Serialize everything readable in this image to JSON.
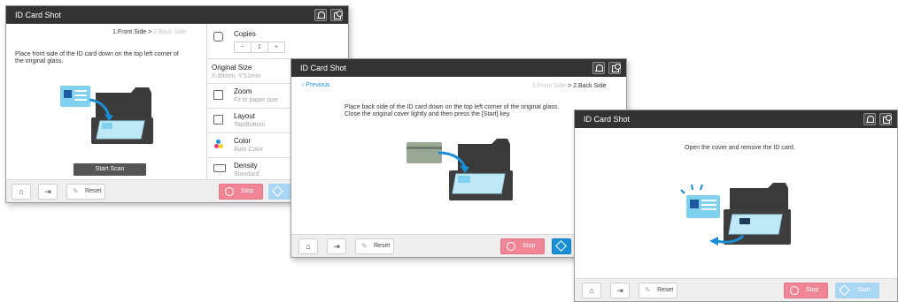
{
  "colors": {
    "titlebar": "#333333",
    "stop": "#f08596",
    "start": "#1a8fd6",
    "card": "#7fd1ef",
    "accent_arrow": "#1a8fd6"
  },
  "screen1": {
    "title": "ID Card Shot",
    "step1": "1.Front Side",
    "sep": ">",
    "step2": "2.Back Side",
    "instruction_line1": "Place front side of the ID card down on the top left corner of",
    "instruction_line2": "the original glass.",
    "start_scan": "Start Scan",
    "settings": {
      "copies_label": "Copies",
      "copies_minus": "−",
      "copies_value": "1",
      "copies_plus": "+",
      "original_size_label": "Original Size",
      "original_size_value": "X:89mm, Y:51mm",
      "zoom_label": "Zoom",
      "zoom_value": "Fit to paper size",
      "layout_label": "Layout",
      "layout_value": "Top/Bottom",
      "color_label": "Color",
      "color_value": "Auto Color",
      "density_label": "Density",
      "density_value": "Standard"
    },
    "reset": "Reset",
    "stop": "Stop"
  },
  "screen2": {
    "title": "ID Card Shot",
    "previous": "Previous",
    "step1": "1.Front Side",
    "sep": ">",
    "step2": "2.Back Side",
    "instruction_line1": "Place back side of the ID card down on the top left corner of the original glass.",
    "instruction_line2": "Close the original cover lightly and then press the [Start] key.",
    "reset": "Reset",
    "stop": "Stop"
  },
  "screen3": {
    "title": "ID Card Shot",
    "instruction": "Open the cover and remove the ID card.",
    "reset": "Reset",
    "stop": "Stop",
    "start": "Start"
  },
  "icons": [
    "bell-icon",
    "job-list-icon",
    "home-icon",
    "logout-icon",
    "reset-icon",
    "stop-icon",
    "start-icon",
    "copies-icon",
    "zoom-icon",
    "layout-icon",
    "color-icon",
    "density-icon",
    "chevron-left-icon"
  ]
}
